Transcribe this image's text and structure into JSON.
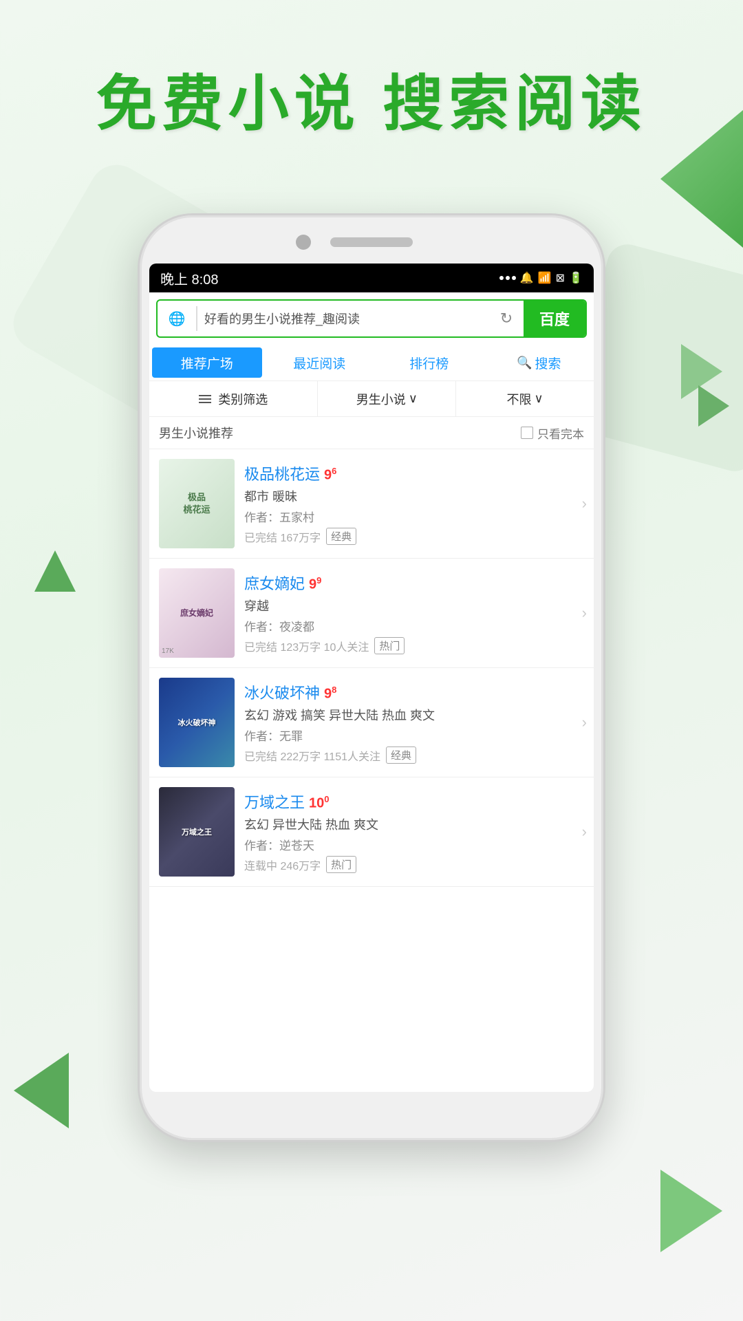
{
  "header": {
    "title": "免费小说  搜索阅读"
  },
  "statusBar": {
    "time": "晚上 8:08",
    "signal": "...",
    "wifi": "WiFi",
    "battery": "充电"
  },
  "searchBar": {
    "query": "好看的男生小说推荐_趣阅读",
    "button": "百度"
  },
  "navTabs": [
    {
      "label": "推荐广场",
      "active": true
    },
    {
      "label": "最近阅读",
      "active": false
    },
    {
      "label": "排行榜",
      "active": false
    },
    {
      "label": "搜索",
      "active": false,
      "hasIcon": true
    }
  ],
  "filterBar": {
    "category": "类别筛选",
    "genre": "男生小说",
    "limit": "不限"
  },
  "sectionHeader": {
    "title": "男生小说推荐",
    "checkbox": "只看完本"
  },
  "books": [
    {
      "title": "极品桃花运",
      "rating": "9",
      "ratingDecimal": "6",
      "genre": "都市 暖昧",
      "author": "作者：五家村",
      "stats": "已完结 167万字",
      "badge": "经典",
      "coverClass": "cover-1",
      "coverLabel": "极品\n桃花运"
    },
    {
      "title": "庶女嫡妃",
      "rating": "9",
      "ratingDecimal": "9",
      "genre": "穿越",
      "author": "作者：夜凌都",
      "stats": "已完结 123万字 10人关注",
      "badge": "热门",
      "coverClass": "cover-2",
      "coverLabel": "庶女嫡妃"
    },
    {
      "title": "冰火破坏神",
      "rating": "9",
      "ratingDecimal": "8",
      "genre": "玄幻 游戏 搞笑 异世大陆 热血 爽文",
      "author": "作者：无罪",
      "stats": "已完结 222万字 1151人关注",
      "badge": "经典",
      "coverClass": "cover-3",
      "coverLabel": "冰火破坏神"
    },
    {
      "title": "万域之王",
      "rating": "10",
      "ratingDecimal": "0",
      "genre": "玄幻 异世大陆 热血 爽文",
      "author": "作者：逆苍天",
      "stats": "连载中 246万字",
      "badge": "热门",
      "coverClass": "cover-4",
      "coverLabel": "万域之王"
    }
  ]
}
